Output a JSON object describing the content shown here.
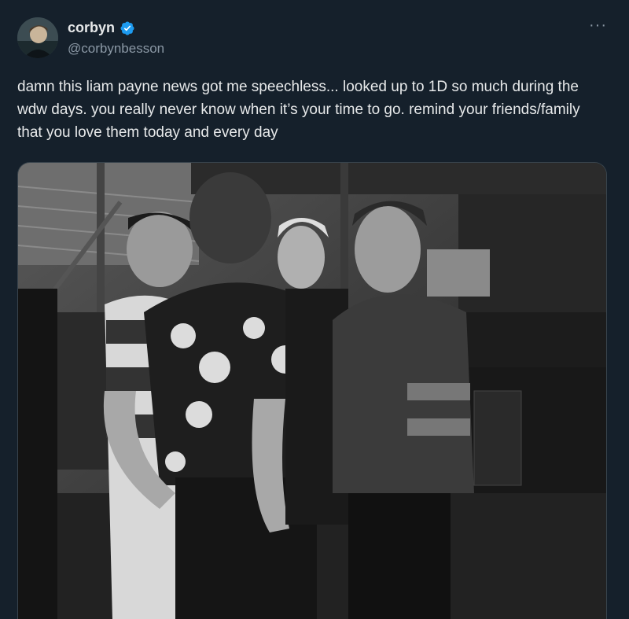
{
  "user": {
    "display_name": "corbyn",
    "handle": "@corbynbesson",
    "verified": true,
    "avatar_icon": "profile-photo"
  },
  "post": {
    "text": "damn this liam payne news got me speechless... looked up to 1D so much during the wdw days. you really never know when it’s your time to go. remind your friends/family that you love them today and every day",
    "more_label": "···"
  },
  "media": {
    "kind": "black-and-white photo",
    "icon": "photo"
  },
  "colors": {
    "background": "#15202b",
    "text": "#e7e9ea",
    "secondary": "#8b98a5",
    "verified": "#1d9bf0"
  }
}
